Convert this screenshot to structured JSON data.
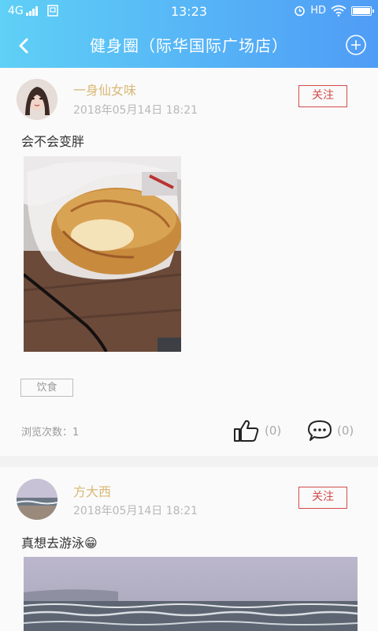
{
  "status_bar": {
    "network": "4G",
    "time": "13:23",
    "hd": "HD"
  },
  "header": {
    "title": "健身圈（际华国际广场店）"
  },
  "colors": {
    "header_start": "#5fd0f6",
    "header_end": "#4f9cf6",
    "username": "#d9b875",
    "follow": "#d24b4b"
  },
  "posts": [
    {
      "username": "一身仙女味",
      "timestamp": "2018年05月14日 18:21",
      "follow_label": "关注",
      "text": "会不会变胖",
      "tag": "饮食",
      "views": "浏览次数：1",
      "likes": "(0)",
      "comments": "(0)",
      "image_description_icon": "bread-photo"
    },
    {
      "username": "方大西",
      "timestamp": "2018年05月14日 18:21",
      "follow_label": "关注",
      "text": "真想去游泳",
      "emoji": "😁",
      "image_description_icon": "sea-photo"
    }
  ]
}
